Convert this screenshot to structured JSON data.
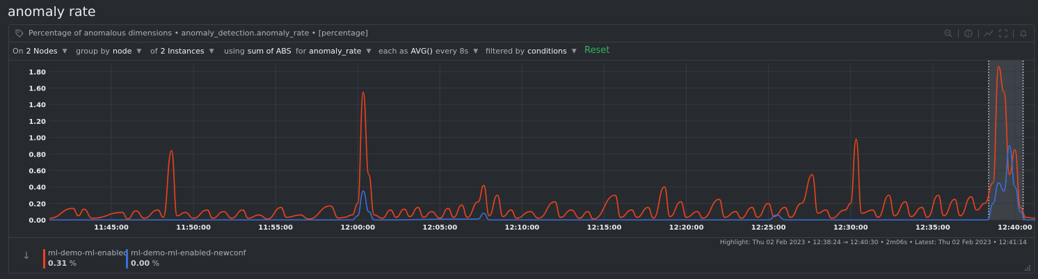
{
  "page": {
    "title": "anomaly rate"
  },
  "card": {
    "title": "Percentage of anomalous dimensions • anomaly_detection.anomaly_rate • [percentage]",
    "actions": [
      "zoom-out-icon",
      "info-icon",
      "chart-type-icon",
      "fullscreen-icon",
      "alert-bell-icon"
    ]
  },
  "controls": {
    "on_label": "On",
    "nodes_value": "2 Nodes",
    "group_label": "group by",
    "group_value": "node",
    "of_label": "of",
    "instances_value": "2 Instances",
    "using_label": "using",
    "using_value": "sum of ABS",
    "for_label": "for",
    "for_value": "anomaly_rate",
    "each_label": "each as",
    "each_value": "AVG()",
    "every_label": "every 8s",
    "filtered_label": "filtered by",
    "filtered_value": "conditions",
    "reset_label": "Reset"
  },
  "highlight_info": "Highlight: Thu 02 Feb 2023 • 12:38:24 → 12:40:30 • 2m06s • Latest: Thu 02 Feb 2023 • 12:41:14",
  "legend": {
    "items": [
      {
        "name": "ml-demo-ml-enabled",
        "value": "0.31",
        "unit": "%",
        "color": "#f0421b"
      },
      {
        "name": "ml-demo-ml-enabled-newconf",
        "value": "0.00",
        "unit": "%",
        "color": "#3c6fd8"
      }
    ]
  },
  "colors": {
    "accent_reset": "#33b35a",
    "background": "#272b30",
    "grid": "#363b41",
    "highlight": "#3d4249"
  },
  "chart_data": {
    "type": "line",
    "x_start": "11:41:14",
    "x_end": "12:41:14",
    "x_ticks": [
      "11:45:00",
      "11:50:00",
      "11:55:00",
      "12:00:00",
      "12:05:00",
      "12:10:00",
      "12:15:00",
      "12:20:00",
      "12:25:00",
      "12:30:00",
      "12:35:00",
      "12:40:00"
    ],
    "y_ticks": [
      "0.00",
      "0.20",
      "0.40",
      "0.60",
      "0.80",
      "1.00",
      "1.20",
      "1.40",
      "1.60",
      "1.80"
    ],
    "ylim": [
      0,
      1.9
    ],
    "grid": true,
    "highlight_range": [
      "12:38:24",
      "12:40:30"
    ],
    "series": [
      {
        "name": "ml-demo-ml-enabled",
        "color": "#f0421b",
        "points": [
          [
            "11:41:14",
            0.02
          ],
          [
            "11:42:40",
            0.14
          ],
          [
            "11:43:00",
            0.05
          ],
          [
            "11:43:20",
            0.13
          ],
          [
            "11:43:50",
            0.02
          ],
          [
            "11:45:40",
            0.09
          ],
          [
            "11:46:00",
            0.01
          ],
          [
            "11:46:30",
            0.11
          ],
          [
            "11:47:00",
            0.02
          ],
          [
            "11:47:50",
            0.12
          ],
          [
            "11:48:10",
            0.03
          ],
          [
            "11:48:40",
            0.84
          ],
          [
            "11:49:00",
            0.05
          ],
          [
            "11:49:30",
            0.09
          ],
          [
            "11:50:00",
            0.02
          ],
          [
            "11:50:50",
            0.12
          ],
          [
            "11:51:10",
            0.02
          ],
          [
            "11:51:50",
            0.1
          ],
          [
            "11:52:20",
            0.02
          ],
          [
            "11:53:00",
            0.12
          ],
          [
            "11:53:20",
            0.02
          ],
          [
            "11:54:00",
            0.06
          ],
          [
            "11:54:30",
            0.01
          ],
          [
            "11:55:20",
            0.15
          ],
          [
            "11:55:40",
            0.03
          ],
          [
            "11:56:30",
            0.06
          ],
          [
            "11:57:00",
            0.01
          ],
          [
            "11:58:20",
            0.17
          ],
          [
            "11:58:50",
            0.02
          ],
          [
            "11:59:10",
            0.03
          ],
          [
            "11:59:40",
            0.06
          ],
          [
            "12:00:00",
            0.2
          ],
          [
            "12:00:20",
            1.55
          ],
          [
            "12:00:40",
            0.55
          ],
          [
            "12:01:00",
            0.06
          ],
          [
            "12:01:30",
            0.02
          ],
          [
            "12:02:00",
            0.12
          ],
          [
            "12:02:20",
            0.03
          ],
          [
            "12:02:50",
            0.13
          ],
          [
            "12:03:10",
            0.04
          ],
          [
            "12:03:40",
            0.15
          ],
          [
            "12:04:00",
            0.03
          ],
          [
            "12:04:30",
            0.1
          ],
          [
            "12:05:00",
            0.02
          ],
          [
            "12:05:30",
            0.14
          ],
          [
            "12:05:50",
            0.03
          ],
          [
            "12:06:20",
            0.18
          ],
          [
            "12:06:40",
            0.03
          ],
          [
            "12:07:20",
            0.22
          ],
          [
            "12:07:40",
            0.42
          ],
          [
            "12:08:00",
            0.05
          ],
          [
            "12:08:30",
            0.3
          ],
          [
            "12:08:50",
            0.04
          ],
          [
            "12:09:20",
            0.12
          ],
          [
            "12:09:40",
            0.02
          ],
          [
            "12:10:30",
            0.1
          ],
          [
            "12:11:00",
            0.02
          ],
          [
            "12:12:00",
            0.22
          ],
          [
            "12:12:20",
            0.03
          ],
          [
            "12:13:00",
            0.12
          ],
          [
            "12:13:30",
            0.02
          ],
          [
            "12:14:00",
            0.1
          ],
          [
            "12:14:20",
            0.01
          ],
          [
            "12:15:40",
            0.3
          ],
          [
            "12:16:00",
            0.03
          ],
          [
            "12:16:40",
            0.12
          ],
          [
            "12:17:00",
            0.03
          ],
          [
            "12:17:40",
            0.15
          ],
          [
            "12:18:00",
            0.02
          ],
          [
            "12:18:40",
            0.4
          ],
          [
            "12:19:00",
            0.04
          ],
          [
            "12:19:40",
            0.22
          ],
          [
            "12:20:00",
            0.03
          ],
          [
            "12:20:40",
            0.1
          ],
          [
            "12:21:00",
            0.02
          ],
          [
            "12:22:00",
            0.25
          ],
          [
            "12:22:20",
            0.03
          ],
          [
            "12:23:00",
            0.1
          ],
          [
            "12:23:20",
            0.02
          ],
          [
            "12:24:00",
            0.15
          ],
          [
            "12:24:20",
            0.03
          ],
          [
            "12:25:00",
            0.2
          ],
          [
            "12:25:20",
            0.04
          ],
          [
            "12:26:00",
            0.15
          ],
          [
            "12:26:20",
            0.03
          ],
          [
            "12:27:00",
            0.2
          ],
          [
            "12:27:40",
            0.55
          ],
          [
            "12:28:00",
            0.08
          ],
          [
            "12:28:30",
            0.12
          ],
          [
            "12:28:50",
            0.02
          ],
          [
            "12:29:40",
            0.12
          ],
          [
            "12:30:00",
            0.2
          ],
          [
            "12:30:20",
            0.98
          ],
          [
            "12:30:40",
            0.08
          ],
          [
            "12:31:20",
            0.12
          ],
          [
            "12:31:40",
            0.03
          ],
          [
            "12:32:20",
            0.3
          ],
          [
            "12:32:40",
            0.05
          ],
          [
            "12:33:20",
            0.22
          ],
          [
            "12:33:40",
            0.04
          ],
          [
            "12:34:20",
            0.15
          ],
          [
            "12:34:40",
            0.03
          ],
          [
            "12:35:20",
            0.3
          ],
          [
            "12:35:40",
            0.05
          ],
          [
            "12:36:20",
            0.25
          ],
          [
            "12:36:40",
            0.05
          ],
          [
            "12:37:20",
            0.28
          ],
          [
            "12:37:40",
            0.12
          ],
          [
            "12:38:10",
            0.2
          ],
          [
            "12:38:40",
            0.45
          ],
          [
            "12:39:00",
            1.86
          ],
          [
            "12:39:20",
            1.55
          ],
          [
            "12:39:40",
            0.55
          ],
          [
            "12:40:00",
            0.85
          ],
          [
            "12:40:20",
            0.15
          ],
          [
            "12:40:40",
            0.03
          ],
          [
            "12:41:14",
            0.02
          ]
        ]
      },
      {
        "name": "ml-demo-ml-enabled-newconf",
        "color": "#3c6fd8",
        "points": [
          [
            "11:41:14",
            0.0
          ],
          [
            "11:59:40",
            0.0
          ],
          [
            "12:00:00",
            0.05
          ],
          [
            "12:00:20",
            0.35
          ],
          [
            "12:00:40",
            0.1
          ],
          [
            "12:01:00",
            0.0
          ],
          [
            "12:07:20",
            0.01
          ],
          [
            "12:07:40",
            0.08
          ],
          [
            "12:08:00",
            0.0
          ],
          [
            "12:25:00",
            0.0
          ],
          [
            "12:25:30",
            0.06
          ],
          [
            "12:26:00",
            0.0
          ],
          [
            "12:38:20",
            0.0
          ],
          [
            "12:38:40",
            0.2
          ],
          [
            "12:39:00",
            0.45
          ],
          [
            "12:39:20",
            0.35
          ],
          [
            "12:39:40",
            0.9
          ],
          [
            "12:40:00",
            0.4
          ],
          [
            "12:40:20",
            0.1
          ],
          [
            "12:40:40",
            0.0
          ],
          [
            "12:41:14",
            0.0
          ]
        ]
      }
    ]
  }
}
